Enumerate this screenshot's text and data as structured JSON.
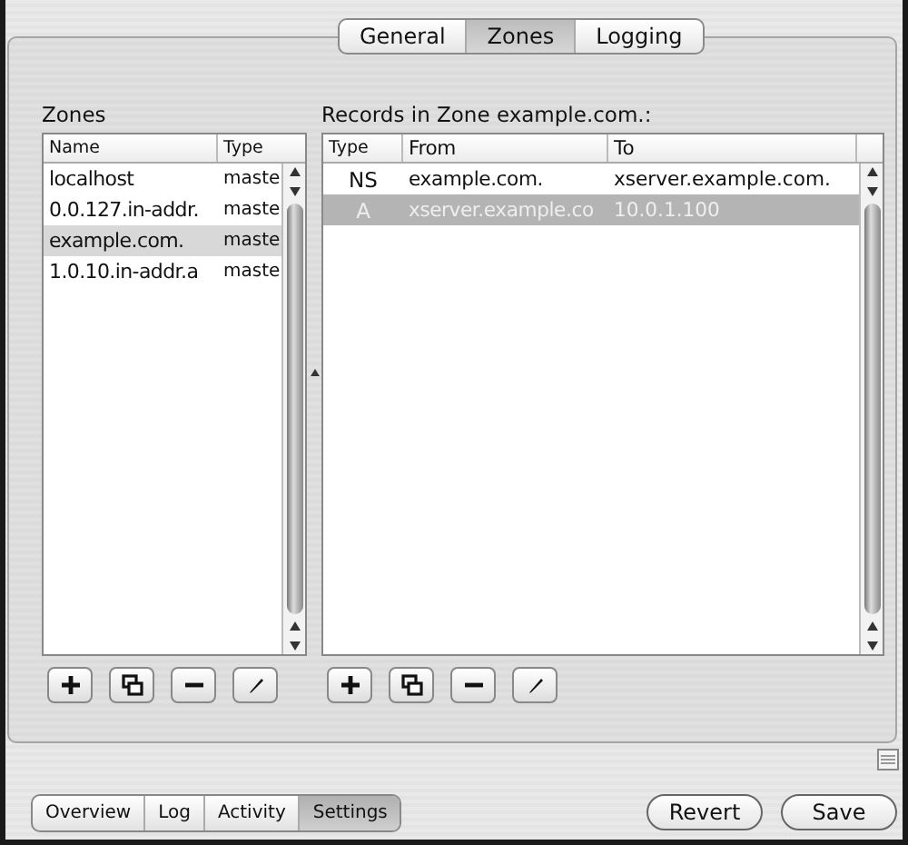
{
  "tabs": [
    {
      "label": "General",
      "selected": false
    },
    {
      "label": "Zones",
      "selected": true
    },
    {
      "label": "Logging",
      "selected": false
    }
  ],
  "zones": {
    "title": "Zones",
    "columns": [
      "Name",
      "Type"
    ],
    "rows": [
      {
        "name": "localhost",
        "type": "maste",
        "selected": false
      },
      {
        "name": "0.0.127.in-addr.",
        "type": "maste",
        "selected": false
      },
      {
        "name": "example.com.",
        "type": "maste",
        "selected": true
      },
      {
        "name": "1.0.10.in-addr.a",
        "type": "maste",
        "selected": false
      }
    ]
  },
  "records": {
    "title": "Records in Zone example.com.:",
    "columns": [
      "Type",
      "From",
      "To"
    ],
    "rows": [
      {
        "type": "NS",
        "from": "example.com.",
        "to": "xserver.example.com.",
        "selected": false
      },
      {
        "type": "A",
        "from": "xserver.example.co",
        "to": "10.0.1.100",
        "selected": true
      }
    ]
  },
  "view_tabs": [
    {
      "label": "Overview",
      "selected": false
    },
    {
      "label": "Log",
      "selected": false
    },
    {
      "label": "Activity",
      "selected": false
    },
    {
      "label": "Settings",
      "selected": true
    }
  ],
  "buttons": [
    "Revert",
    "Save"
  ]
}
